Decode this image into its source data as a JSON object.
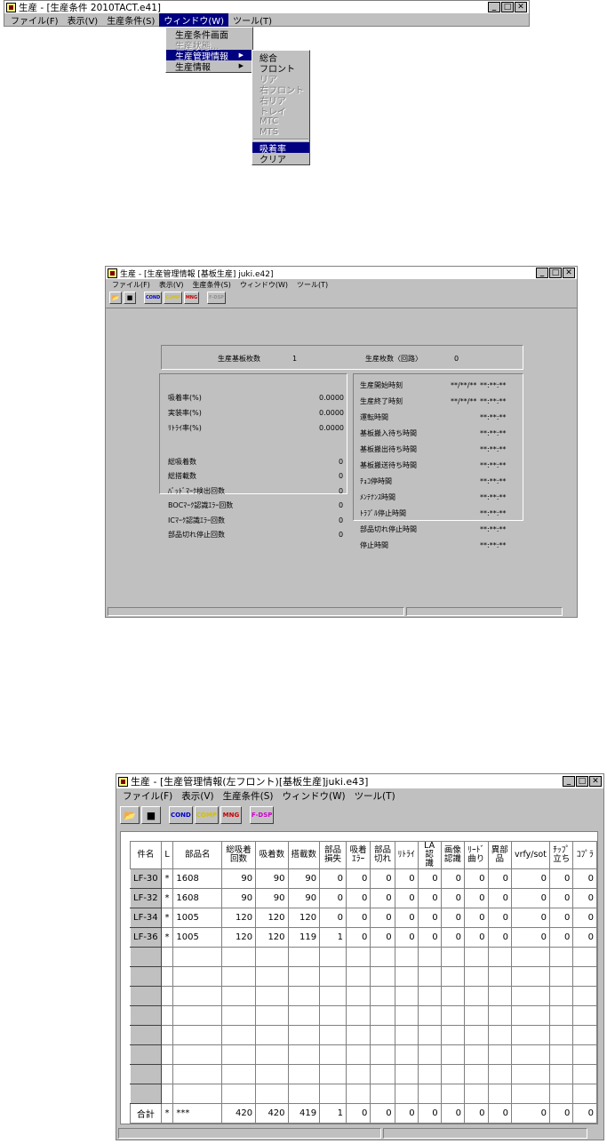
{
  "win1": {
    "title": "生産 - [生産条件 2010TACT.e41]",
    "menu": [
      "ファイル(F)",
      "表示(V)",
      "生産条件(S)",
      "ウィンドウ(W)",
      "ツール(T)"
    ],
    "window_menu": [
      {
        "label": "生産条件画面",
        "disabled": false,
        "submenu": false
      },
      {
        "label": "生産状態...",
        "disabled": true,
        "submenu": false
      },
      {
        "label": "生産管理情報",
        "disabled": false,
        "submenu": true,
        "selected": true
      },
      {
        "label": "生産情報",
        "disabled": false,
        "submenu": true
      }
    ],
    "sub_menu_top": [
      {
        "label": "総合",
        "disabled": false
      },
      {
        "label": "フロント",
        "disabled": false
      },
      {
        "label": "リア",
        "disabled": true
      },
      {
        "label": "右フロント",
        "disabled": true
      },
      {
        "label": "右リア",
        "disabled": true
      },
      {
        "label": "トレイ",
        "disabled": true
      },
      {
        "label": "MTC",
        "disabled": true
      },
      {
        "label": "MTS",
        "disabled": true
      }
    ],
    "sub_menu_bottom": [
      {
        "label": "吸着率",
        "disabled": false,
        "selected": true
      },
      {
        "label": "クリア",
        "disabled": false
      }
    ]
  },
  "win2": {
    "title": "生産 - [生産管理情報 [基板生産] juki.e42]",
    "menu": [
      "ファイル(F)",
      "表示(V)",
      "生産条件(S)",
      "ウィンドウ(W)",
      "ツール(T)"
    ],
    "header_left_label": "生産基板枚数",
    "header_left_value": "1",
    "header_right_label": "生産枚数〈回路〉",
    "header_right_value": "0",
    "rates": [
      {
        "label": "吸着率(%)",
        "value": "0.0000"
      },
      {
        "label": "実装率(%)",
        "value": "0.0000"
      },
      {
        "label": "ﾘﾄﾗｲ率(%)",
        "value": "0.0000"
      }
    ],
    "counts": [
      {
        "label": "総吸着数",
        "value": "0"
      },
      {
        "label": "総搭載数",
        "value": "0"
      },
      {
        "label": "ﾊﾞｯﾄﾞﾏｰｸ検出回数",
        "value": "0"
      },
      {
        "label": "BOCﾏｰｸ認識ｴﾗｰ回数",
        "value": "0"
      },
      {
        "label": "ICﾏｰｸ認識ｴﾗｰ回数",
        "value": "0"
      },
      {
        "label": "部品切れ停止回数",
        "value": "0"
      }
    ],
    "times": [
      {
        "label": "生産開始時刻",
        "date": "**/**/**",
        "time": "**:**:**"
      },
      {
        "label": "生産終了時刻",
        "date": "**/**/**",
        "time": "**:**:**"
      },
      {
        "label": "運転時間",
        "date": "",
        "time": "**:**:**"
      },
      {
        "label": "基板搬入待ち時間",
        "date": "",
        "time": "**:**:**"
      },
      {
        "label": "基板搬出待ち時間",
        "date": "",
        "time": "**:**:**"
      },
      {
        "label": "基板搬送待ち時間",
        "date": "",
        "time": "**:**:**"
      },
      {
        "label": "ﾁｮｺ停時間",
        "date": "",
        "time": "**:**:**"
      },
      {
        "label": "ﾒﾝﾃﾅﾝｽ時間",
        "date": "",
        "time": "**:**:**"
      },
      {
        "label": "ﾄﾗﾌﾞﾙ停止時間",
        "date": "",
        "time": "**:**:**"
      },
      {
        "label": "部品切れ停止時間",
        "date": "",
        "time": "**:**:**"
      },
      {
        "label": "停止時間",
        "date": "",
        "time": "**:**:**"
      }
    ]
  },
  "win3": {
    "title": "生産 - [生産管理情報(左フロント)[基板生産]juki.e43]",
    "menu": [
      "ファイル(F)",
      "表示(V)",
      "生産条件(S)",
      "ウィンドウ(W)",
      "ツール(T)"
    ],
    "toolbar": {
      "cond": "COND",
      "comp": "COMP",
      "mng": "MNG",
      "fdsp": "F-DSP"
    },
    "columns": [
      "件名",
      "L",
      "部品名",
      "総吸着回数",
      "吸着数",
      "搭載数",
      "部品損失",
      "吸着ｴﾗｰ",
      "部品切れ",
      "ﾘﾄﾗｲ",
      "LA認識",
      "画像認識",
      "ﾘｰﾄﾞ曲り",
      "異部品",
      "vrfy/sot",
      "ﾁｯﾌﾟ立ち",
      "ｺﾌﾟﾗ"
    ],
    "rows": [
      [
        "LF-30",
        "*",
        "1608",
        "90",
        "90",
        "90",
        "0",
        "0",
        "0",
        "0",
        "0",
        "0",
        "0",
        "0",
        "0",
        "0",
        "0"
      ],
      [
        "LF-32",
        "*",
        "1608",
        "90",
        "90",
        "90",
        "0",
        "0",
        "0",
        "0",
        "0",
        "0",
        "0",
        "0",
        "0",
        "0",
        "0"
      ],
      [
        "LF-34",
        "*",
        "1005",
        "120",
        "120",
        "120",
        "0",
        "0",
        "0",
        "0",
        "0",
        "0",
        "0",
        "0",
        "0",
        "0",
        "0"
      ],
      [
        "LF-36",
        "*",
        "1005",
        "120",
        "120",
        "119",
        "1",
        "0",
        "0",
        "0",
        "0",
        "0",
        "0",
        "0",
        "0",
        "0",
        "0"
      ]
    ],
    "empty_rows": 8,
    "total_row": [
      "合計",
      "*",
      "***",
      "420",
      "420",
      "419",
      "1",
      "0",
      "0",
      "0",
      "0",
      "0",
      "0",
      "0",
      "0",
      "0",
      "0"
    ]
  }
}
